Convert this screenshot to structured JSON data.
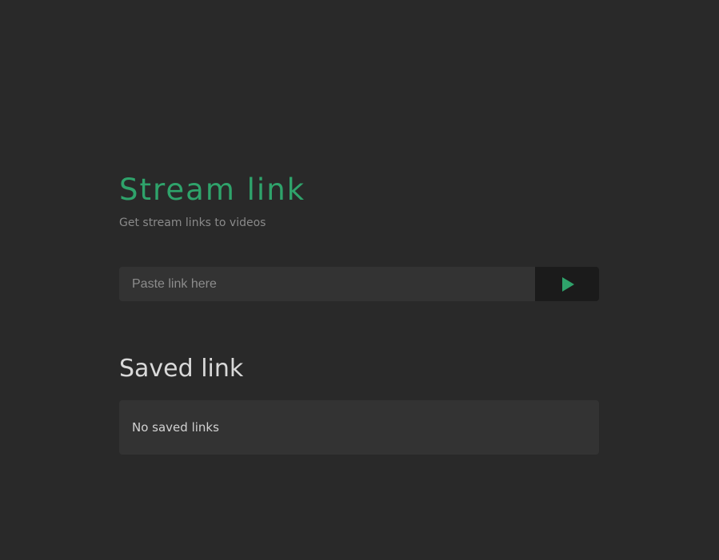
{
  "header": {
    "title": "Stream link",
    "subtitle": "Get stream links to videos"
  },
  "form": {
    "input_value": "",
    "input_placeholder": "Paste link here",
    "submit_icon": "play-icon"
  },
  "saved": {
    "heading": "Saved link",
    "empty_text": "No saved links"
  },
  "colors": {
    "background": "#292929",
    "accent": "#2fa36b",
    "panel": "#333333",
    "button": "#1b1b1b"
  }
}
